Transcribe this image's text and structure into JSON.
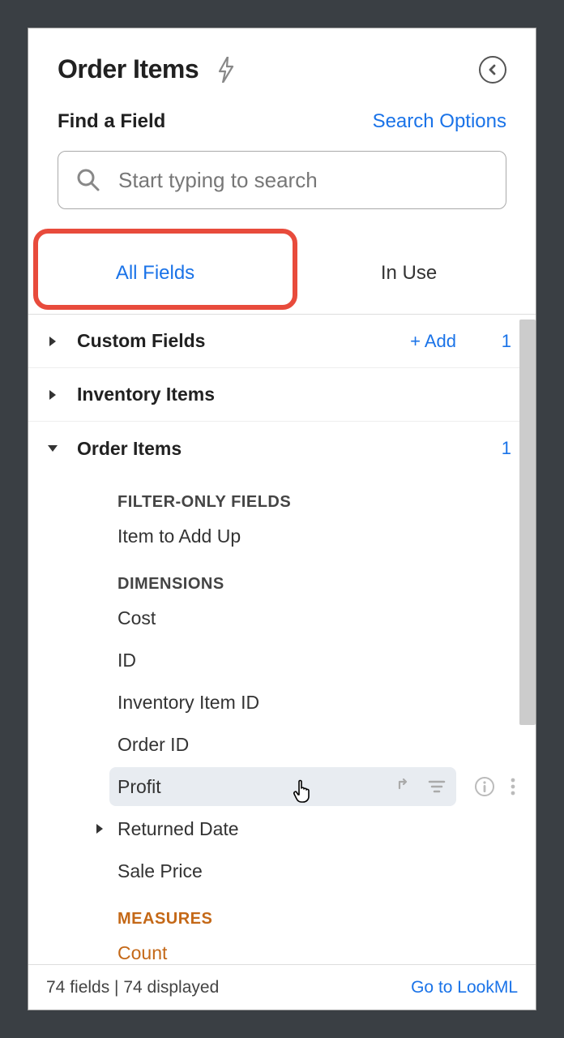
{
  "header": {
    "title": "Order Items"
  },
  "search": {
    "find_label": "Find a Field",
    "options_label": "Search Options",
    "placeholder": "Start typing to search"
  },
  "tabs": {
    "all_fields": "All Fields",
    "in_use": "In Use"
  },
  "groups": {
    "custom_fields": {
      "label": "Custom Fields",
      "add_label": "+  Add",
      "count": "1"
    },
    "inventory_items": {
      "label": "Inventory Items"
    },
    "order_items": {
      "label": "Order Items",
      "count": "1"
    }
  },
  "sections": {
    "filter_only": "FILTER-ONLY FIELDS",
    "dimensions": "DIMENSIONS",
    "measures": "MEASURES"
  },
  "fields": {
    "item_to_add_up": "Item to Add Up",
    "cost": "Cost",
    "id": "ID",
    "inventory_item_id": "Inventory Item ID",
    "order_id": "Order ID",
    "profit": "Profit",
    "returned_date": "Returned Date",
    "sale_price": "Sale Price",
    "count": "Count"
  },
  "footer": {
    "status": "74 fields | 74 displayed",
    "link": "Go to LookML"
  }
}
